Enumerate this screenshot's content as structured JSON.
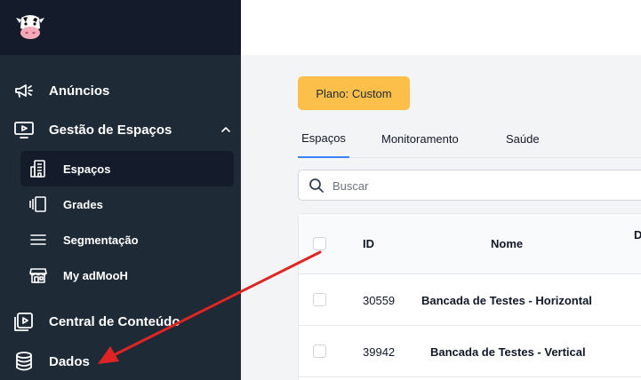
{
  "sidebar": {
    "logo": "cow-logo",
    "items": [
      {
        "label": "Anúncios",
        "icon": "megaphone-icon"
      },
      {
        "label": "Gestão de Espaços",
        "icon": "monitor-play-icon",
        "expanded": true
      },
      {
        "label": "Central de Conteúdo",
        "icon": "play-square-icon"
      },
      {
        "label": "Dados",
        "icon": "database-icon"
      }
    ],
    "subitems": [
      {
        "label": "Espaços",
        "icon": "building-icon",
        "active": true
      },
      {
        "label": "Grades",
        "icon": "grid-columns-icon"
      },
      {
        "label": "Segmentação",
        "icon": "menu-lines-icon"
      },
      {
        "label": "My adMooH",
        "icon": "store-icon"
      }
    ]
  },
  "main": {
    "plan_badge": "Plano: Custom",
    "tabs": [
      {
        "label": "Espaços",
        "active": true
      },
      {
        "label": "Monitoramento"
      },
      {
        "label": "Saúde"
      }
    ],
    "search": {
      "placeholder": "Buscar"
    },
    "table": {
      "columns": [
        "ID",
        "Nome",
        "D"
      ],
      "rows": [
        {
          "id": "30559",
          "name": "Bancada de Testes - Horizontal"
        },
        {
          "id": "39942",
          "name": "Bancada de Testes - Vertical"
        }
      ]
    }
  },
  "colors": {
    "sidebar_bg": "#1f2a37",
    "sidebar_top_bg": "#141c2b",
    "badge_bg": "#fbbf4a",
    "tab_active": "#3b82f6",
    "annotation_arrow": "#e02424"
  }
}
